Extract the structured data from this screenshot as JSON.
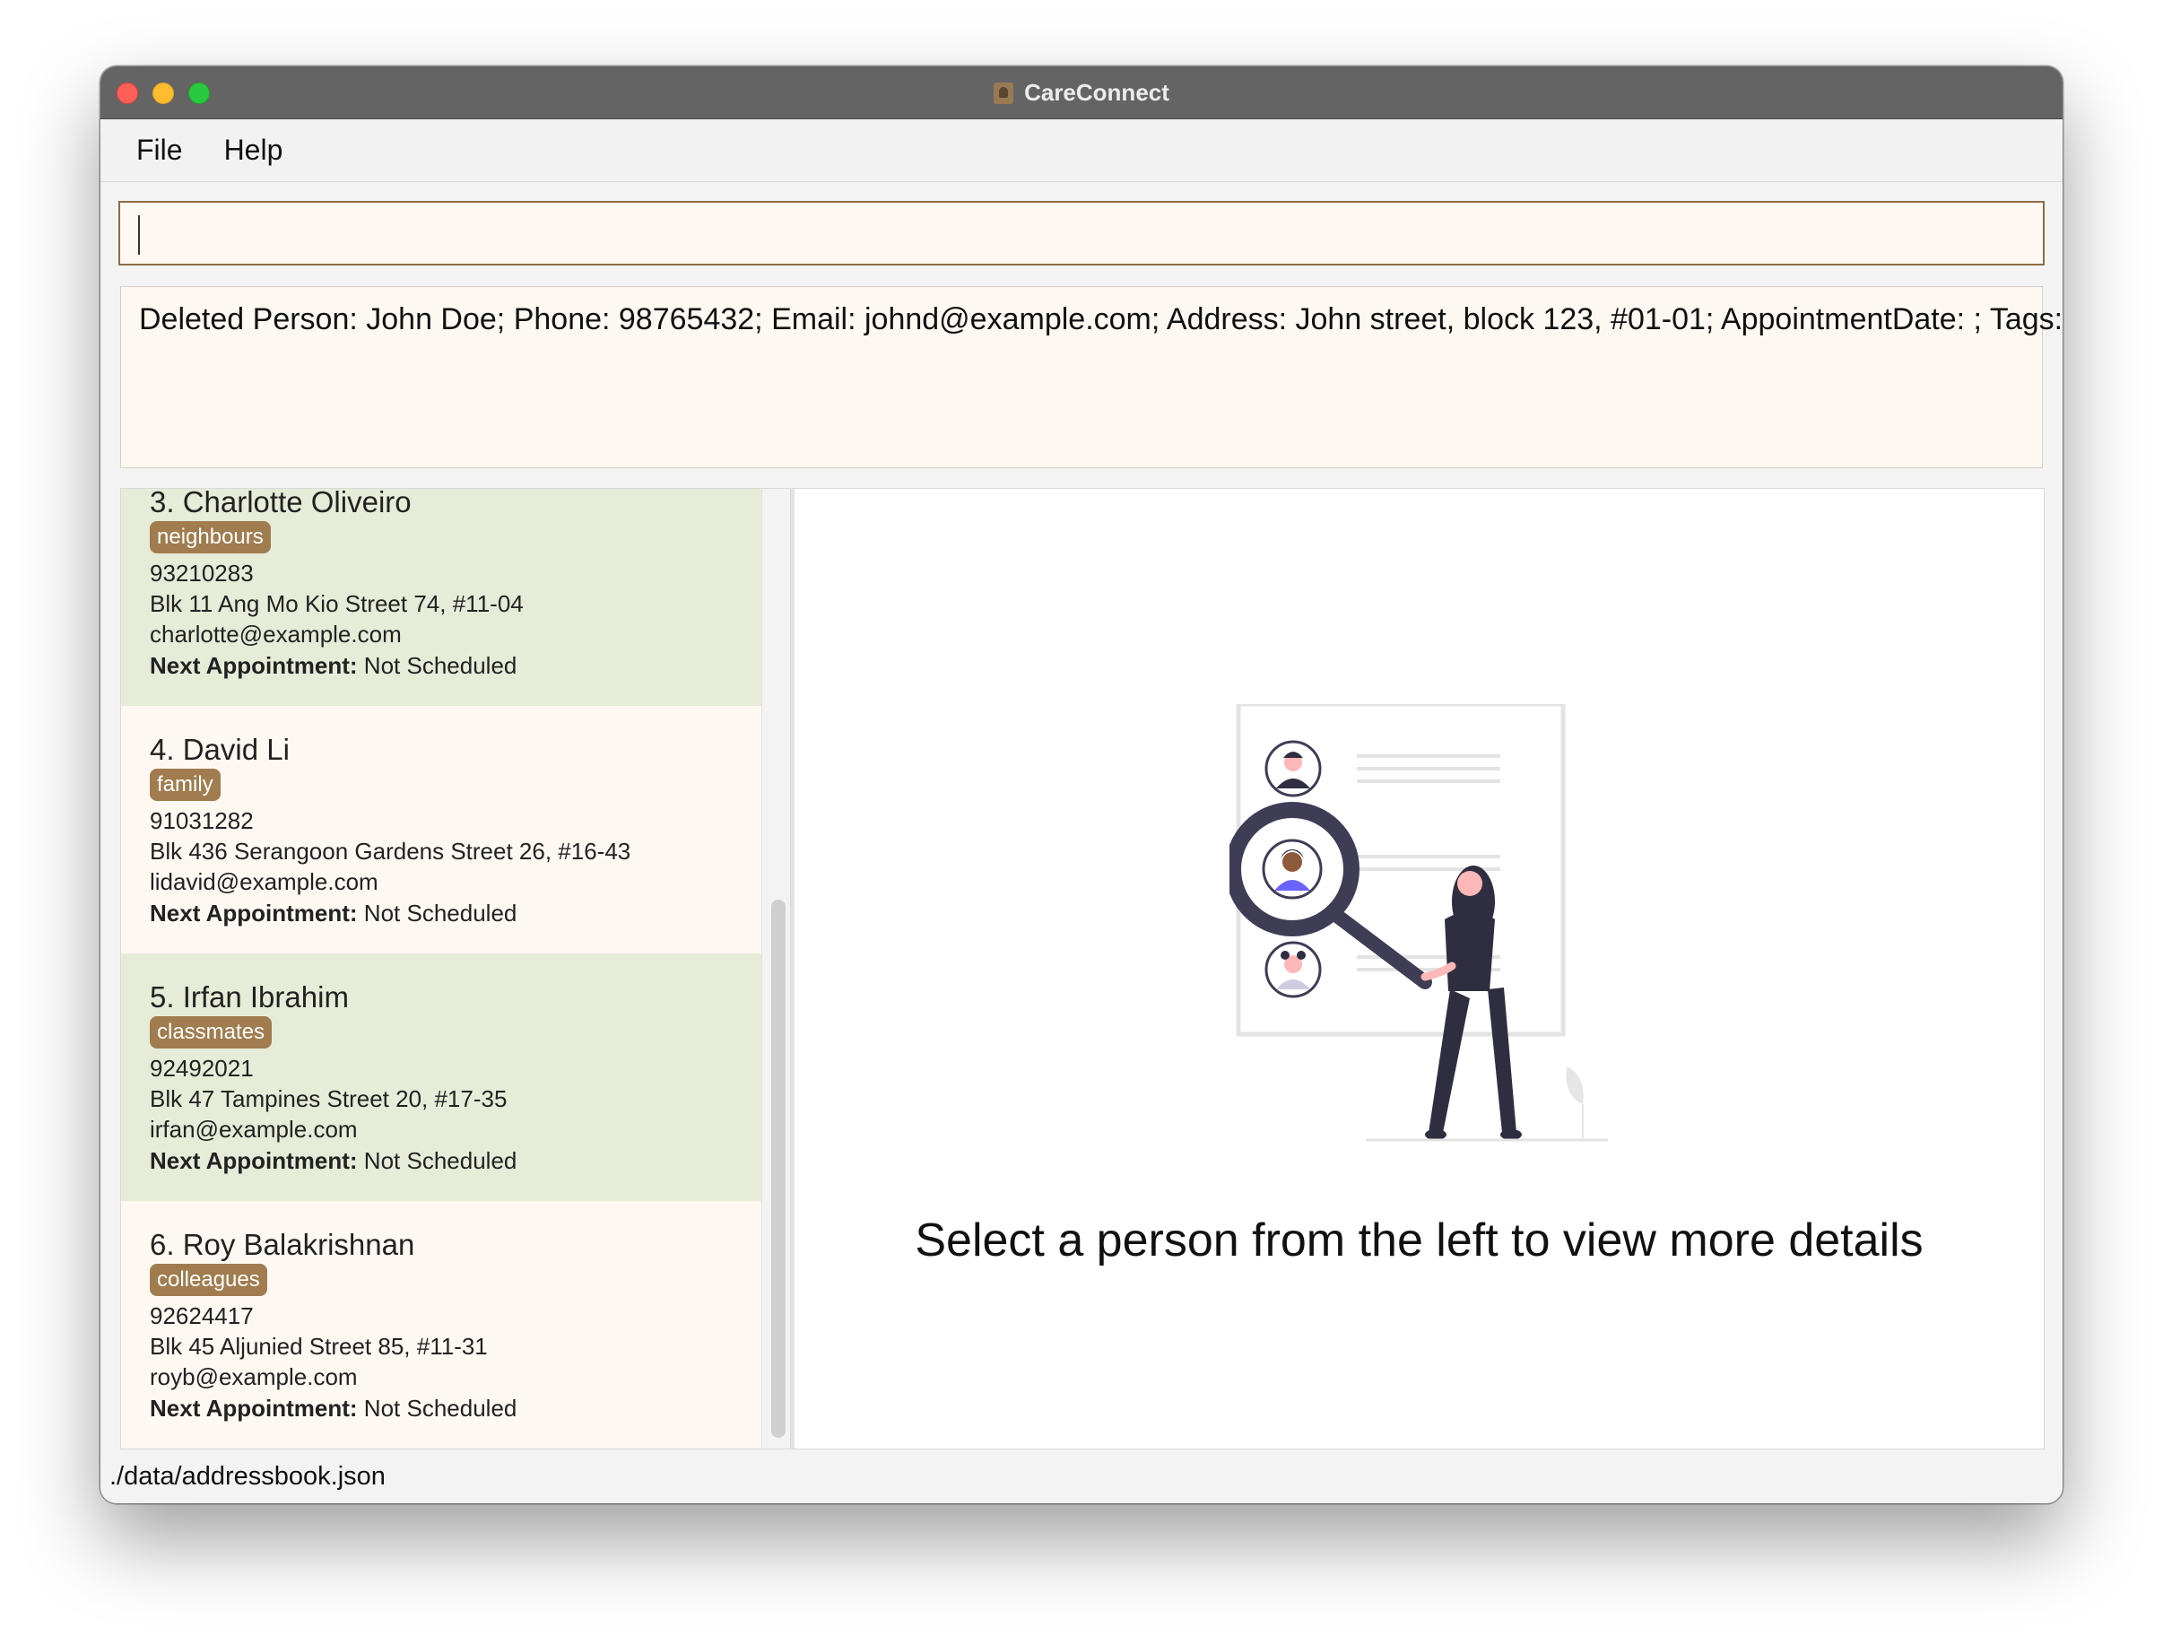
{
  "window": {
    "title": "CareConnect"
  },
  "menu": {
    "items": [
      "File",
      "Help"
    ]
  },
  "command": {
    "value": ""
  },
  "result": {
    "text": "Deleted Person: John Doe; Phone: 98765432; Email: johnd@example.com; Address: John street, block 123, #01-01; AppointmentDate: ; Tags:"
  },
  "persons": [
    {
      "name": "3. Charlotte Oliveiro",
      "tag": "neighbours",
      "phone": "93210283",
      "address": "Blk 11 Ang Mo Kio Street 74, #11-04",
      "email": "charlotte@example.com",
      "appointment_label": "Next Appointment:",
      "appointment_value": " Not Scheduled"
    },
    {
      "name": "4. David Li",
      "tag": "family",
      "phone": "91031282",
      "address": "Blk 436 Serangoon Gardens Street 26, #16-43",
      "email": "lidavid@example.com",
      "appointment_label": "Next Appointment:",
      "appointment_value": " Not Scheduled"
    },
    {
      "name": "5. Irfan Ibrahim",
      "tag": "classmates",
      "phone": "92492021",
      "address": "Blk 47 Tampines Street 20, #17-35",
      "email": "irfan@example.com",
      "appointment_label": "Next Appointment:",
      "appointment_value": " Not Scheduled"
    },
    {
      "name": "6. Roy Balakrishnan",
      "tag": "colleagues",
      "phone": "92624417",
      "address": "Blk 45 Aljunied Street 85, #11-31",
      "email": "royb@example.com",
      "appointment_label": "Next Appointment:",
      "appointment_value": " Not Scheduled"
    }
  ],
  "detail": {
    "hint": "Select a person from the left to view more details"
  },
  "status": {
    "path": "./data/addressbook.json"
  },
  "colors": {
    "tag": "#a07c4f",
    "card_alt": "#e7ecd8",
    "card_base": "#fdf8f2",
    "border": "#8a6d45"
  }
}
